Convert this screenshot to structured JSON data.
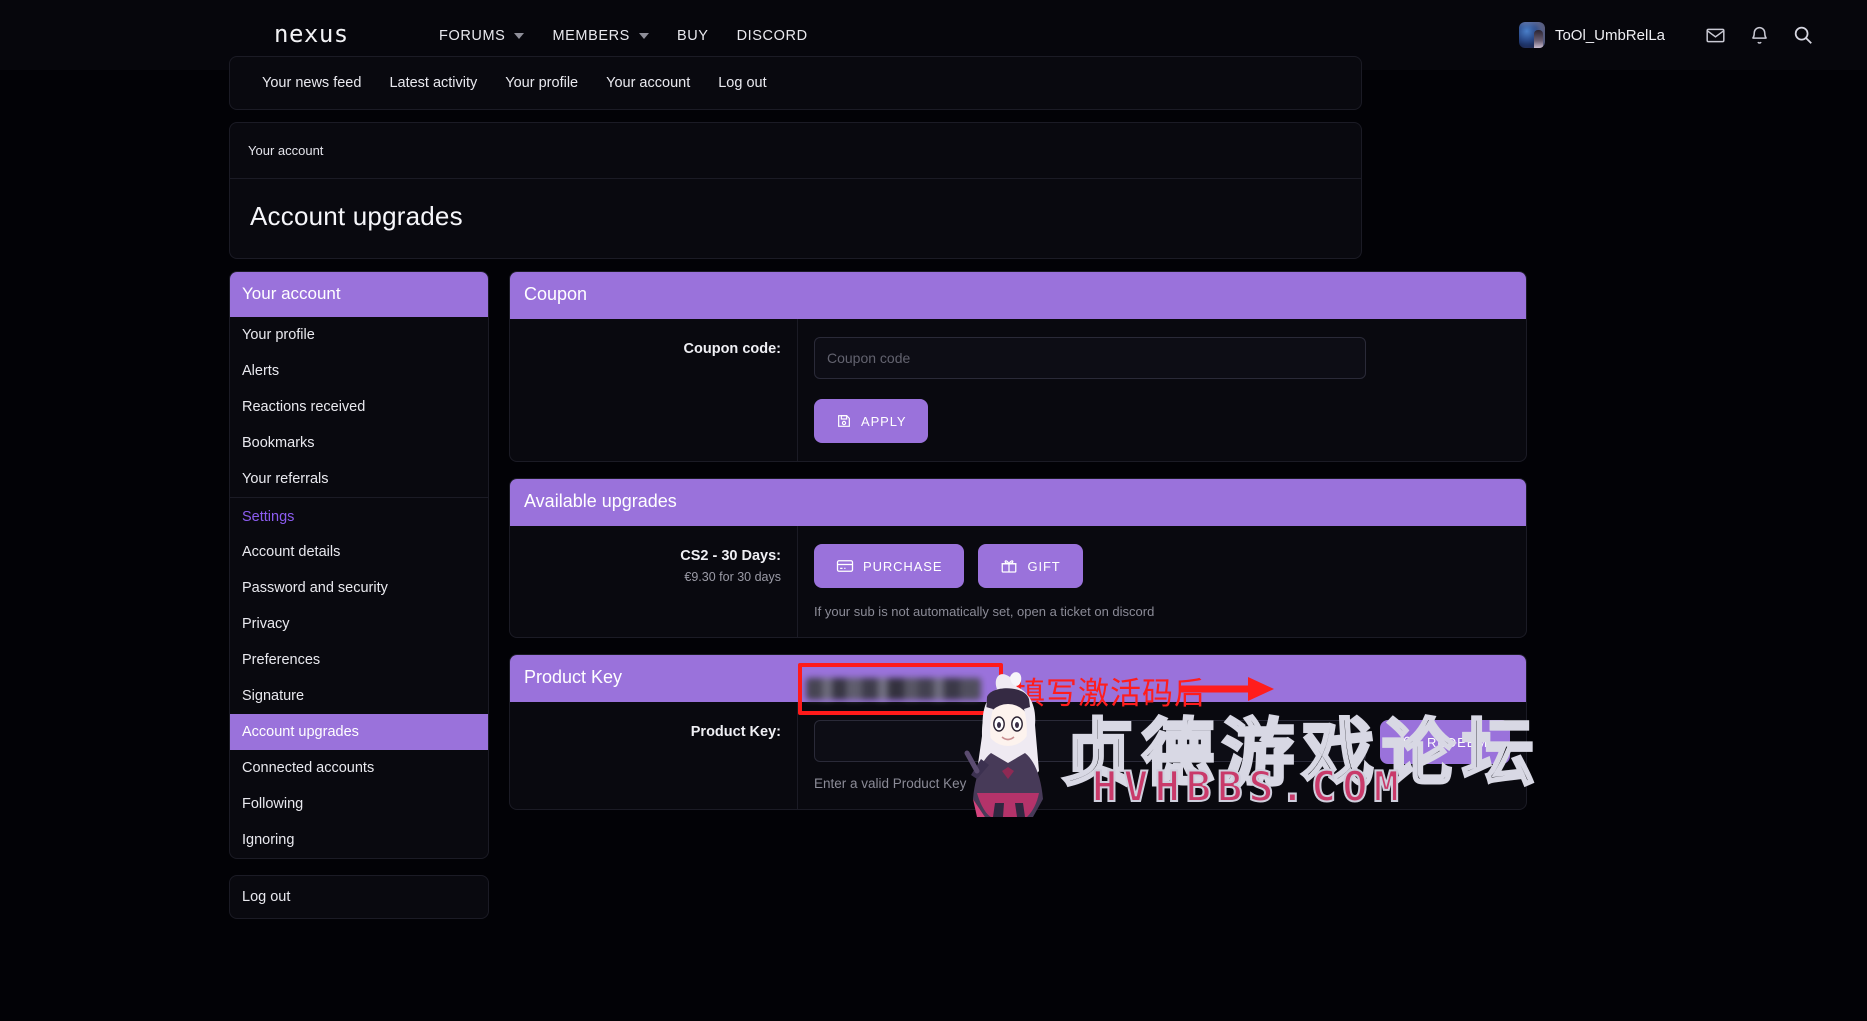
{
  "header": {
    "brand": "nexus",
    "nav": [
      {
        "label": "FORUMS",
        "has_caret": true
      },
      {
        "label": "MEMBERS",
        "has_caret": true
      },
      {
        "label": "BUY",
        "has_caret": false
      },
      {
        "label": "DISCORD",
        "has_caret": false
      }
    ],
    "username": "ToOl_UmbRelLa",
    "icons": [
      "envelope-icon",
      "bell-icon",
      "search-icon"
    ]
  },
  "subnav": {
    "items": [
      "Your news feed",
      "Latest activity",
      "Your profile",
      "Your account",
      "Log out"
    ]
  },
  "breadcrumb": "Your account",
  "page_title": "Account upgrades",
  "sidebar": {
    "heading": "Your account",
    "items_top": [
      "Your profile",
      "Alerts",
      "Reactions received",
      "Bookmarks",
      "Your referrals"
    ],
    "group_label": "Settings",
    "items_settings": [
      {
        "label": "Account details",
        "active": false
      },
      {
        "label": "Password and security",
        "active": false
      },
      {
        "label": "Privacy",
        "active": false
      },
      {
        "label": "Preferences",
        "active": false
      },
      {
        "label": "Signature",
        "active": false
      },
      {
        "label": "Account upgrades",
        "active": true
      },
      {
        "label": "Connected accounts",
        "active": false
      },
      {
        "label": "Following",
        "active": false
      },
      {
        "label": "Ignoring",
        "active": false
      }
    ],
    "logout": "Log out"
  },
  "coupon": {
    "title": "Coupon",
    "label": "Coupon code:",
    "placeholder": "Coupon code",
    "value": "",
    "apply_label": "APPLY"
  },
  "upgrades": {
    "title": "Available upgrades",
    "item_name": "CS2 - 30 Days:",
    "item_price": "€9.30 for 30 days",
    "purchase_label": "PURCHASE",
    "gift_label": "GIFT",
    "note": "If your sub is not automatically set, open a ticket on discord"
  },
  "product_key": {
    "title": "Product Key",
    "label": "Product Key:",
    "value": "",
    "hint": "Enter a valid Product Key",
    "redeem_label": "REDEEM"
  },
  "annotation": {
    "text": "填写激活码后"
  },
  "watermark": {
    "title": "贞德游戏论坛",
    "url": "HVHBBS.COM"
  },
  "colors": {
    "accent": "#9a72db",
    "group_label": "#8c5cf0",
    "background": "#020206",
    "card": "#09090f",
    "annotation_red": "#ff1d1d"
  }
}
